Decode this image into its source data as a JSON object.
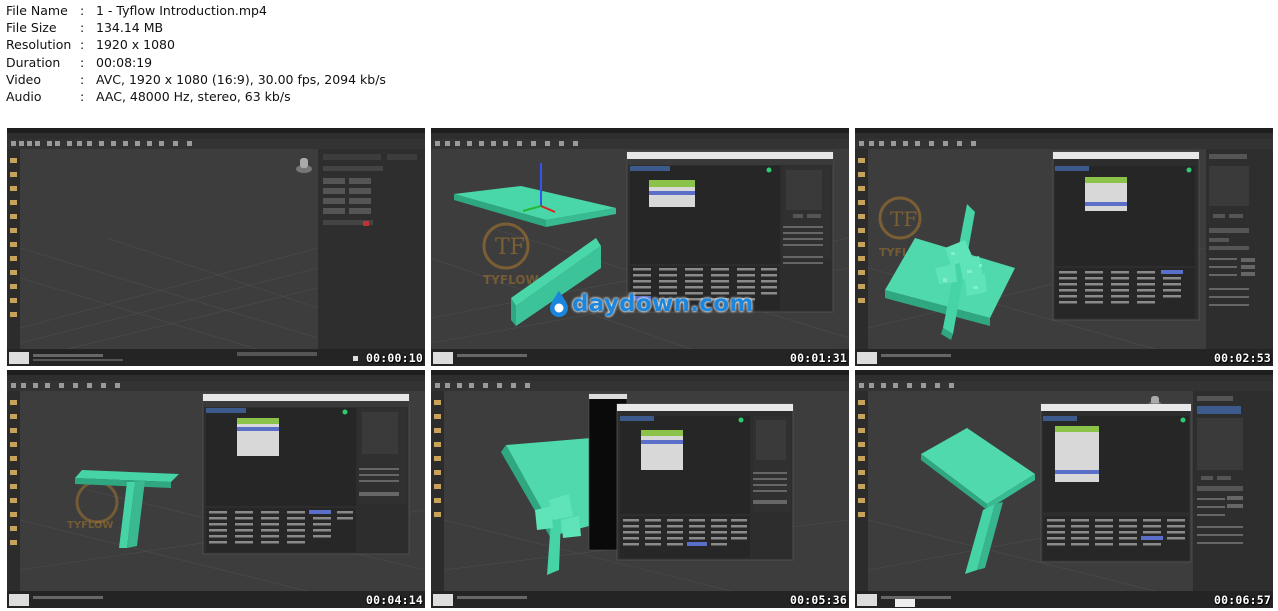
{
  "file_info": [
    {
      "label": "File Name",
      "value": "1 - Tyflow Introduction.mp4"
    },
    {
      "label": "File Size",
      "value": "134.14 MB"
    },
    {
      "label": "Resolution",
      "value": "1920 x 1080"
    },
    {
      "label": "Duration",
      "value": "00:08:19"
    },
    {
      "label": "Video",
      "value": "AVC, 1920 x 1080 (16:9), 30.00 fps, 2094 kb/s"
    },
    {
      "label": "Audio",
      "value": "AAC, 48000 Hz, stereo, 63 kb/s"
    }
  ],
  "separator": ":",
  "thumbnails": [
    {
      "timestamp": "00:00:10"
    },
    {
      "timestamp": "00:01:31"
    },
    {
      "timestamp": "00:02:53"
    },
    {
      "timestamp": "00:04:14"
    },
    {
      "timestamp": "00:05:36"
    },
    {
      "timestamp": "00:06:57"
    }
  ],
  "watermark": {
    "text": "daydown.com",
    "color": "#1c86dc"
  },
  "colors": {
    "object": "#46d3a6",
    "viewport": "#3a3a3a",
    "ui": "#2b2b2b"
  }
}
